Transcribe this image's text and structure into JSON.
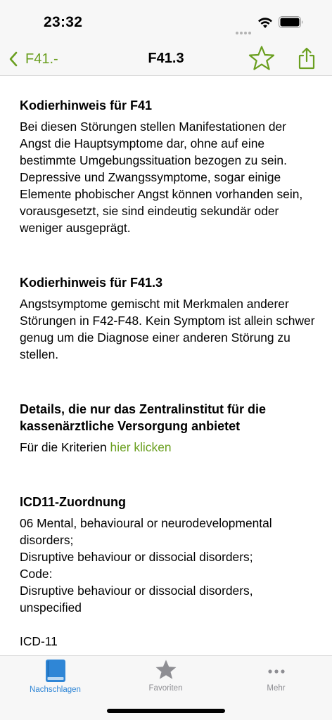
{
  "status_bar": {
    "time": "23:32"
  },
  "nav": {
    "back_label": "F41.-",
    "title": "F41.3"
  },
  "sections": [
    {
      "heading": "Kodierhinweis für F41",
      "body": "Bei diesen Störungen stellen Manifestationen der Angst die Hauptsymptome dar, ohne auf eine bestimmte Umgebungssituation bezogen zu sein. Depressive und Zwangssymptome, sogar einige Elemente phobischer Angst können vorhanden sein, vorausgesetzt, sie sind eindeutig sekundär oder weniger ausgeprägt."
    },
    {
      "heading": "Kodierhinweis für F41.3",
      "body": "Angstsymptome gemischt mit Merkmalen anderer Störungen in F42-F48. Kein Symptom ist allein schwer genug um die Diagnose einer anderen Störung zu stellen."
    },
    {
      "heading": "Details, die nur das Zentralinstitut für die kassenärztliche Versorgung anbietet",
      "body_prefix": "Für die Kriterien ",
      "link_text": "hier klicken"
    },
    {
      "heading": "ICD11-Zuordnung",
      "lines": [
        "06 Mental, behavioural or neurodevelopmental disorders;",
        "Disruptive behaviour or dissocial disorders;",
        "Code:",
        "Disruptive behaviour or dissocial disorders, unspecified"
      ],
      "trailing": "ICD-11"
    }
  ],
  "tabs": [
    {
      "label": "Nachschlagen",
      "icon": "book-icon",
      "active": true
    },
    {
      "label": "Favoriten",
      "icon": "star-icon",
      "active": false
    },
    {
      "label": "Mehr",
      "icon": "more-icon",
      "active": false
    }
  ],
  "colors": {
    "accent": "#6a9f1f",
    "tab_active": "#2f86d6",
    "tab_inactive": "#8e8e93"
  }
}
